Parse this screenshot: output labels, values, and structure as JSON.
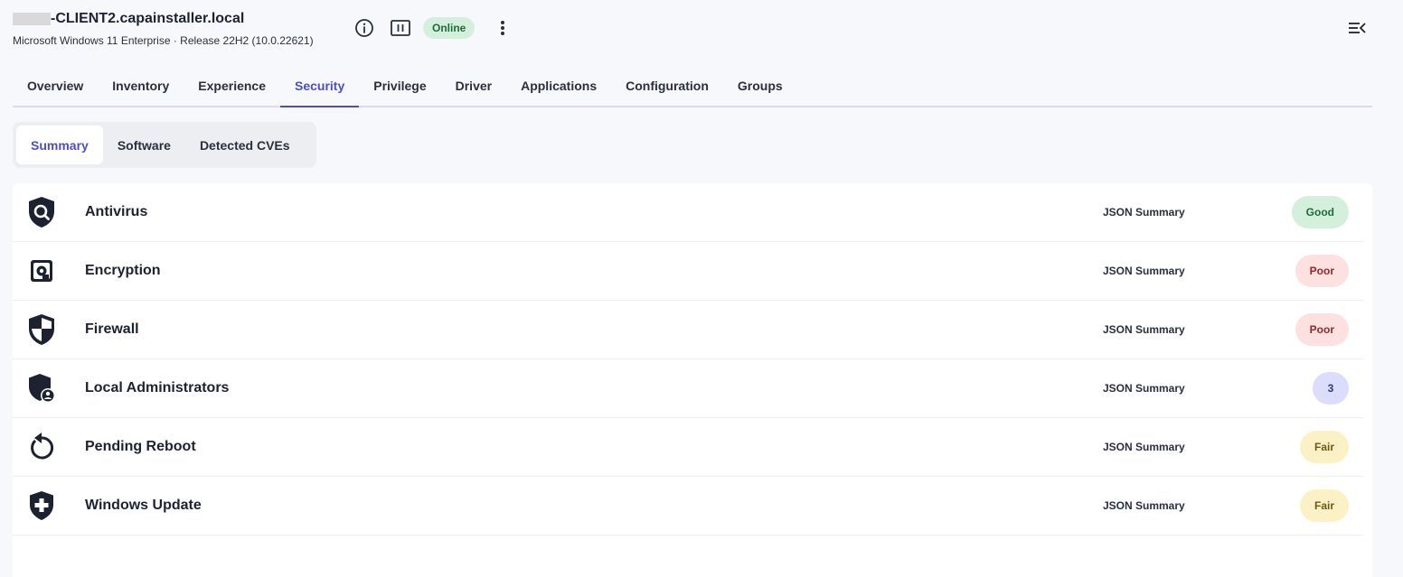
{
  "header": {
    "hostname": "-CLIENT2.capainstaller.local",
    "os_line": "Microsoft Windows 11 Enterprise · Release 22H2 (10.0.22621)",
    "status": "Online",
    "icons": [
      "info-icon",
      "pause-icon",
      "more-vertical-icon",
      "collapse-panel-icon"
    ]
  },
  "tabs": [
    {
      "label": "Overview"
    },
    {
      "label": "Inventory"
    },
    {
      "label": "Experience"
    },
    {
      "label": "Security",
      "active": true
    },
    {
      "label": "Privilege"
    },
    {
      "label": "Driver"
    },
    {
      "label": "Applications"
    },
    {
      "label": "Configuration"
    },
    {
      "label": "Groups"
    }
  ],
  "subtabs": [
    {
      "label": "Summary",
      "active": true
    },
    {
      "label": "Software"
    },
    {
      "label": "Detected CVEs"
    }
  ],
  "rows": [
    {
      "title": "Antivirus",
      "link": "JSON Summary",
      "badge": "Good",
      "icon": "shield-search-icon"
    },
    {
      "title": "Encryption",
      "link": "JSON Summary",
      "badge": "Poor",
      "icon": "disk-icon"
    },
    {
      "title": "Firewall",
      "link": "JSON Summary",
      "badge": "Poor",
      "icon": "shield-half-icon"
    },
    {
      "title": "Local Administrators",
      "link": "JSON Summary",
      "badge": "3",
      "icon": "shield-user-icon"
    },
    {
      "title": "Pending Reboot",
      "link": "JSON Summary",
      "badge": "Fair",
      "icon": "restart-icon"
    },
    {
      "title": "Windows Update",
      "link": "JSON Summary",
      "badge": "Fair",
      "icon": "shield-plus-icon"
    }
  ],
  "colors": {
    "accent": "#4a4fc9",
    "good_bg": "#d4f0dd",
    "poor_bg": "#fde0e0",
    "fair_bg": "#fbf1c4",
    "count_bg": "#dcddfa"
  }
}
